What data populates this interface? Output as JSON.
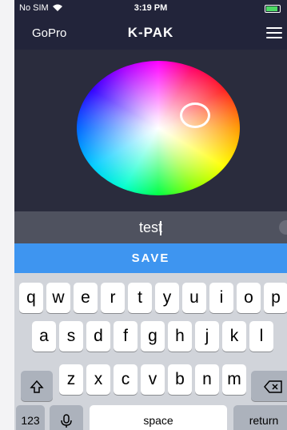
{
  "status": {
    "carrier": "No SIM",
    "time": "3:19 PM",
    "battery_level": 0.85
  },
  "nav": {
    "back_label": "GoPro",
    "title": "K-PAK"
  },
  "name_input": {
    "value": "test"
  },
  "save_label": "SAVE",
  "keyboard": {
    "row1": [
      "q",
      "w",
      "e",
      "r",
      "t",
      "y",
      "u",
      "i",
      "o",
      "p"
    ],
    "row2": [
      "a",
      "s",
      "d",
      "f",
      "g",
      "h",
      "j",
      "k",
      "l"
    ],
    "row3": [
      "z",
      "x",
      "c",
      "v",
      "b",
      "n",
      "m"
    ],
    "numbers_label": "123",
    "space_label": "space",
    "return_label": "return"
  },
  "colors": {
    "accent": "#3e95f0",
    "background": "#2a2c3d",
    "bar": "#22243a"
  }
}
